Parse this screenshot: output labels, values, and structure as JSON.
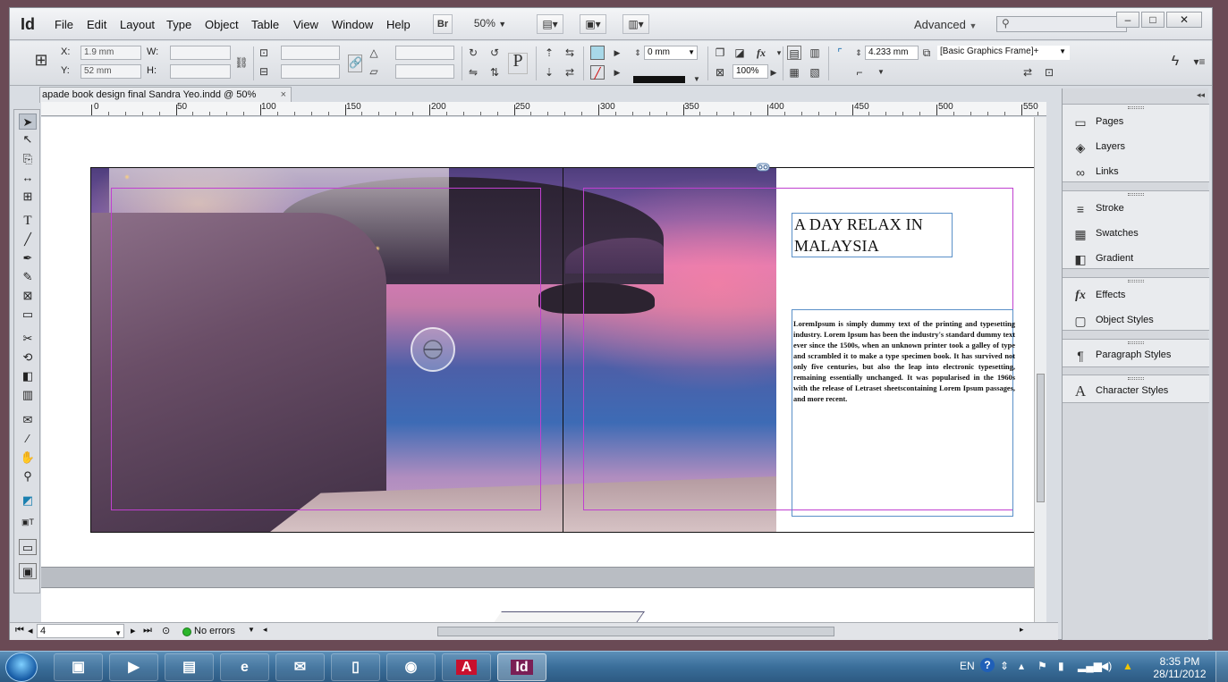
{
  "app": {
    "logo": "Id",
    "menu": [
      "File",
      "Edit",
      "Layout",
      "Type",
      "Object",
      "Table",
      "View",
      "Window",
      "Help"
    ],
    "bridge_label": "Br",
    "zoom": "50%",
    "workspace": "Advanced"
  },
  "controls": {
    "x_label": "X:",
    "x_value": "1.9 mm",
    "y_label": "Y:",
    "y_value": "52 mm",
    "w_label": "W:",
    "h_label": "H:",
    "stroke_weight": "0 mm",
    "opacity": "100%",
    "corner_size": "4.233 mm",
    "object_style": "[Basic Graphics Frame]+"
  },
  "document": {
    "tab_title": "apade book design final Sandra Yeo.indd @ 50%",
    "tab_close": "×"
  },
  "ruler": [
    "0",
    "50",
    "100",
    "150",
    "200",
    "250",
    "300",
    "350",
    "400",
    "450",
    "500",
    "550"
  ],
  "layout": {
    "title": "A DAY RELAX IN MALAYSIA",
    "body": "LoremIpsum is simply dummy text of the printing and typesetting industry. Lorem Ipsum has been the industry's standard dummy text ever since the 1500s, when an unknown printer took a galley of type and scrambled it to make a type specimen book. It has survived not only five centuries, but also the leap into electronic typesetting, remaining essentially unchanged. It was popularised in the 1960s with the release of Letraset sheetscontaining Lorem Ipsum passages, and more recent."
  },
  "status": {
    "page": "4",
    "preflight": "No errors"
  },
  "panels": [
    {
      "label": "Pages",
      "icon": "pages-icon",
      "glyph": "▭"
    },
    {
      "label": "Layers",
      "icon": "layers-icon",
      "glyph": "◈"
    },
    {
      "label": "Links",
      "icon": "links-icon",
      "glyph": "∞"
    },
    {
      "label": "Stroke",
      "icon": "stroke-icon",
      "glyph": "≡"
    },
    {
      "label": "Swatches",
      "icon": "swatches-icon",
      "glyph": "▦"
    },
    {
      "label": "Gradient",
      "icon": "gradient-icon",
      "glyph": "◧"
    },
    {
      "label": "Effects",
      "icon": "effects-icon",
      "glyph": "fx"
    },
    {
      "label": "Object Styles",
      "icon": "object-styles-icon",
      "glyph": "▢"
    },
    {
      "label": "Paragraph Styles",
      "icon": "paragraph-styles-icon",
      "glyph": "¶"
    },
    {
      "label": "Character Styles",
      "icon": "character-styles-icon",
      "glyph": "A"
    }
  ],
  "taskbar": {
    "language": "EN",
    "time": "8:35 PM",
    "date": "28/11/2012",
    "indesign_label": "Id"
  },
  "colors": {
    "guide": "#c040d0",
    "frame": "#5a90c8",
    "taskbar": "#3a6e9a"
  }
}
